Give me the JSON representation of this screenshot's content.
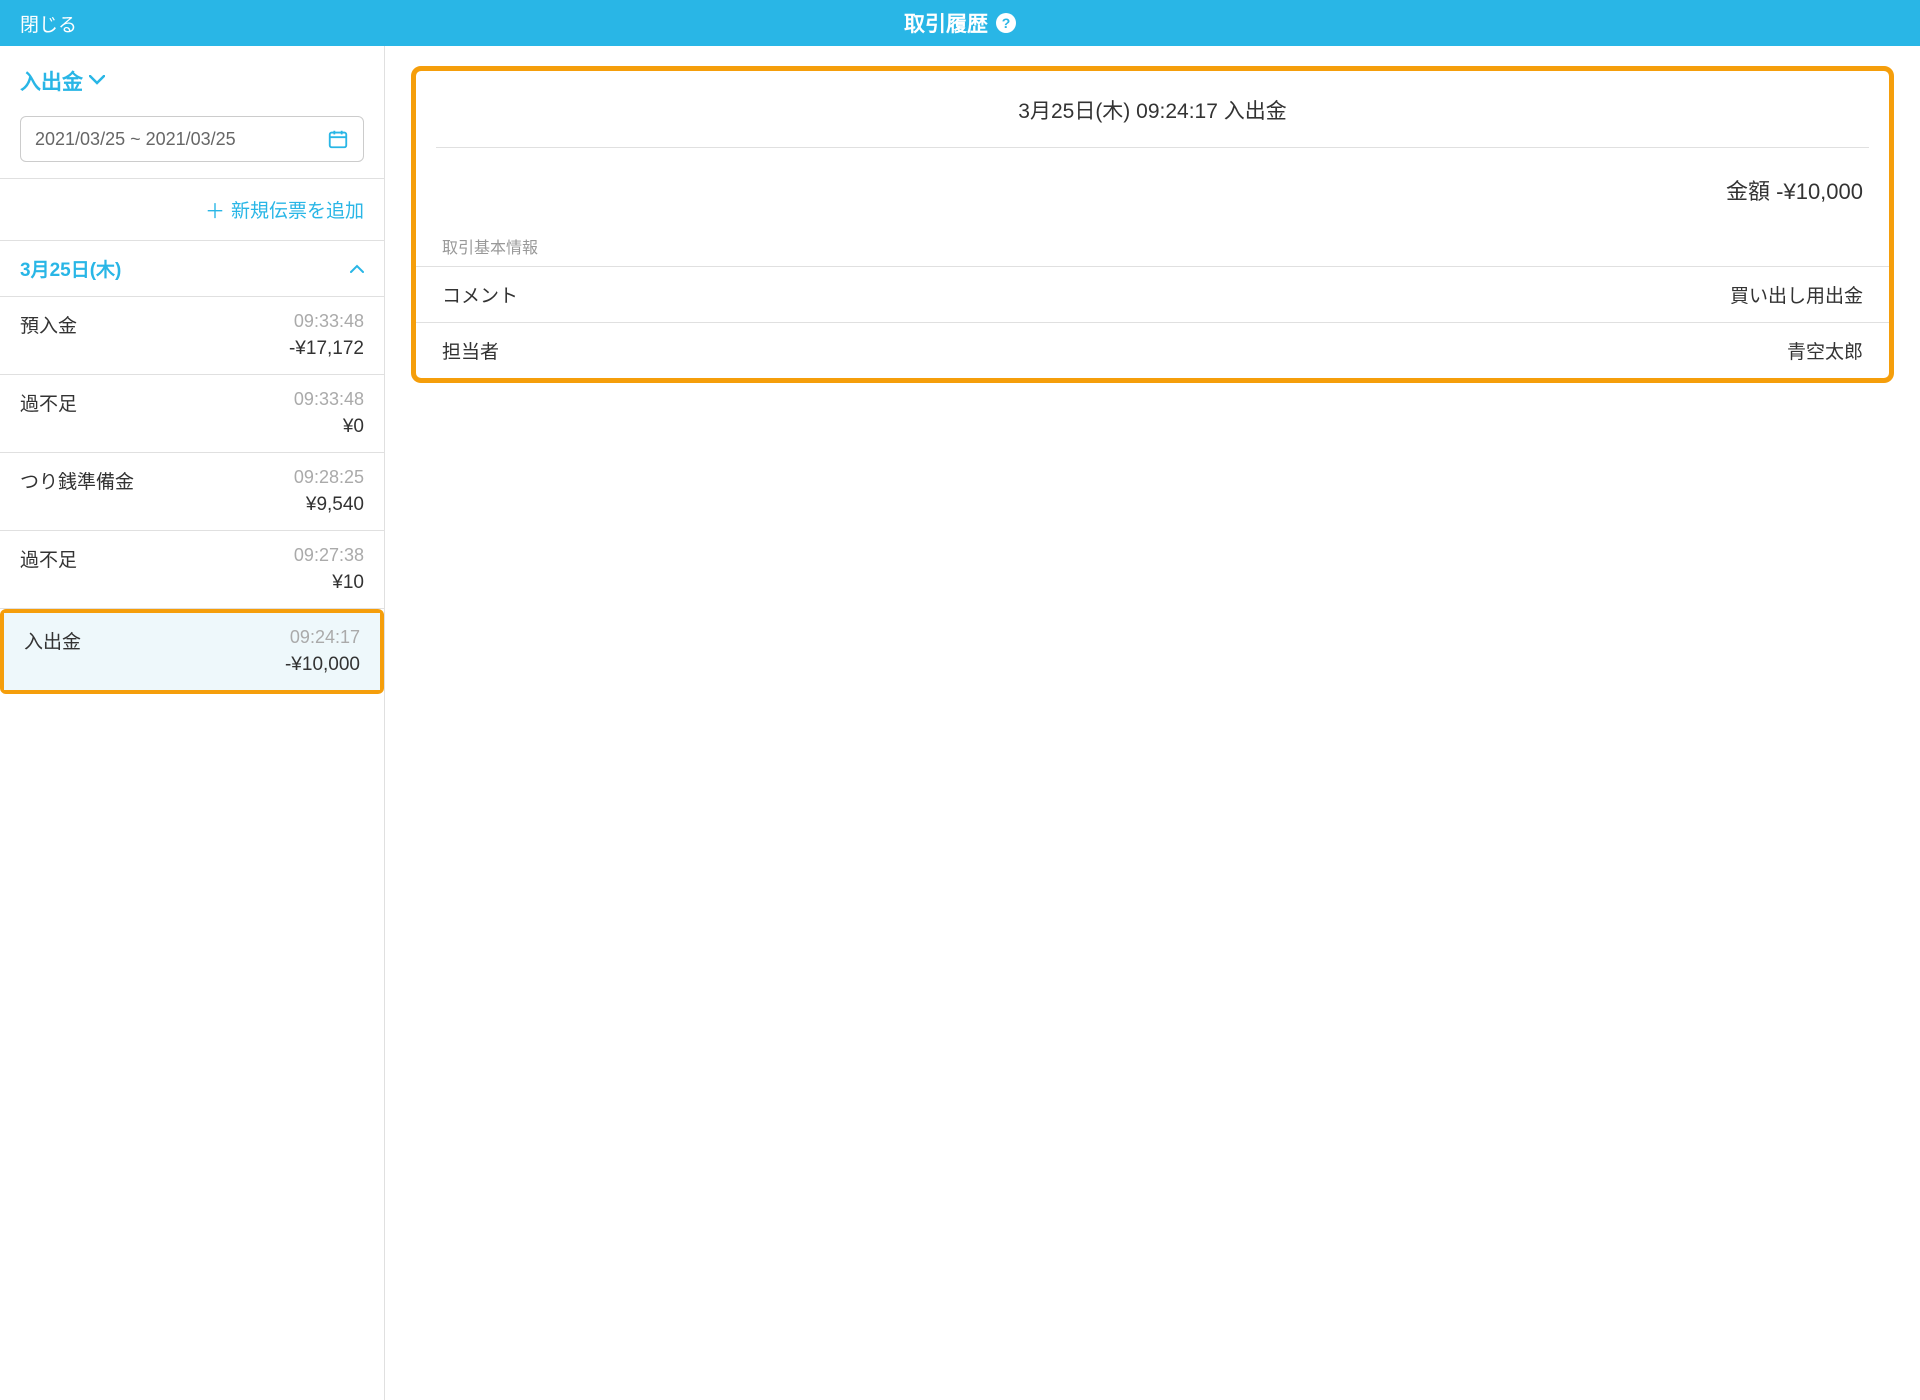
{
  "header": {
    "close_label": "閉じる",
    "title": "取引履歴"
  },
  "sidebar": {
    "filter_label": "入出金",
    "date_range": "2021/03/25 ~ 2021/03/25",
    "add_slip_label": "新規伝票を追加",
    "date_group": "3月25日(木)",
    "transactions": [
      {
        "label": "預入金",
        "time": "09:33:48",
        "amount": "-¥17,172"
      },
      {
        "label": "過不足",
        "time": "09:33:48",
        "amount": "¥0"
      },
      {
        "label": "つり銭準備金",
        "time": "09:28:25",
        "amount": "¥9,540"
      },
      {
        "label": "過不足",
        "time": "09:27:38",
        "amount": "¥10"
      },
      {
        "label": "入出金",
        "time": "09:24:17",
        "amount": "-¥10,000"
      }
    ]
  },
  "detail": {
    "title": "3月25日(木) 09:24:17 入出金",
    "amount_label": "金額",
    "amount_value": "-¥10,000",
    "section_label": "取引基本情報",
    "rows": [
      {
        "label": "コメント",
        "value": "買い出し用出金"
      },
      {
        "label": "担当者",
        "value": "青空太郎"
      }
    ]
  }
}
